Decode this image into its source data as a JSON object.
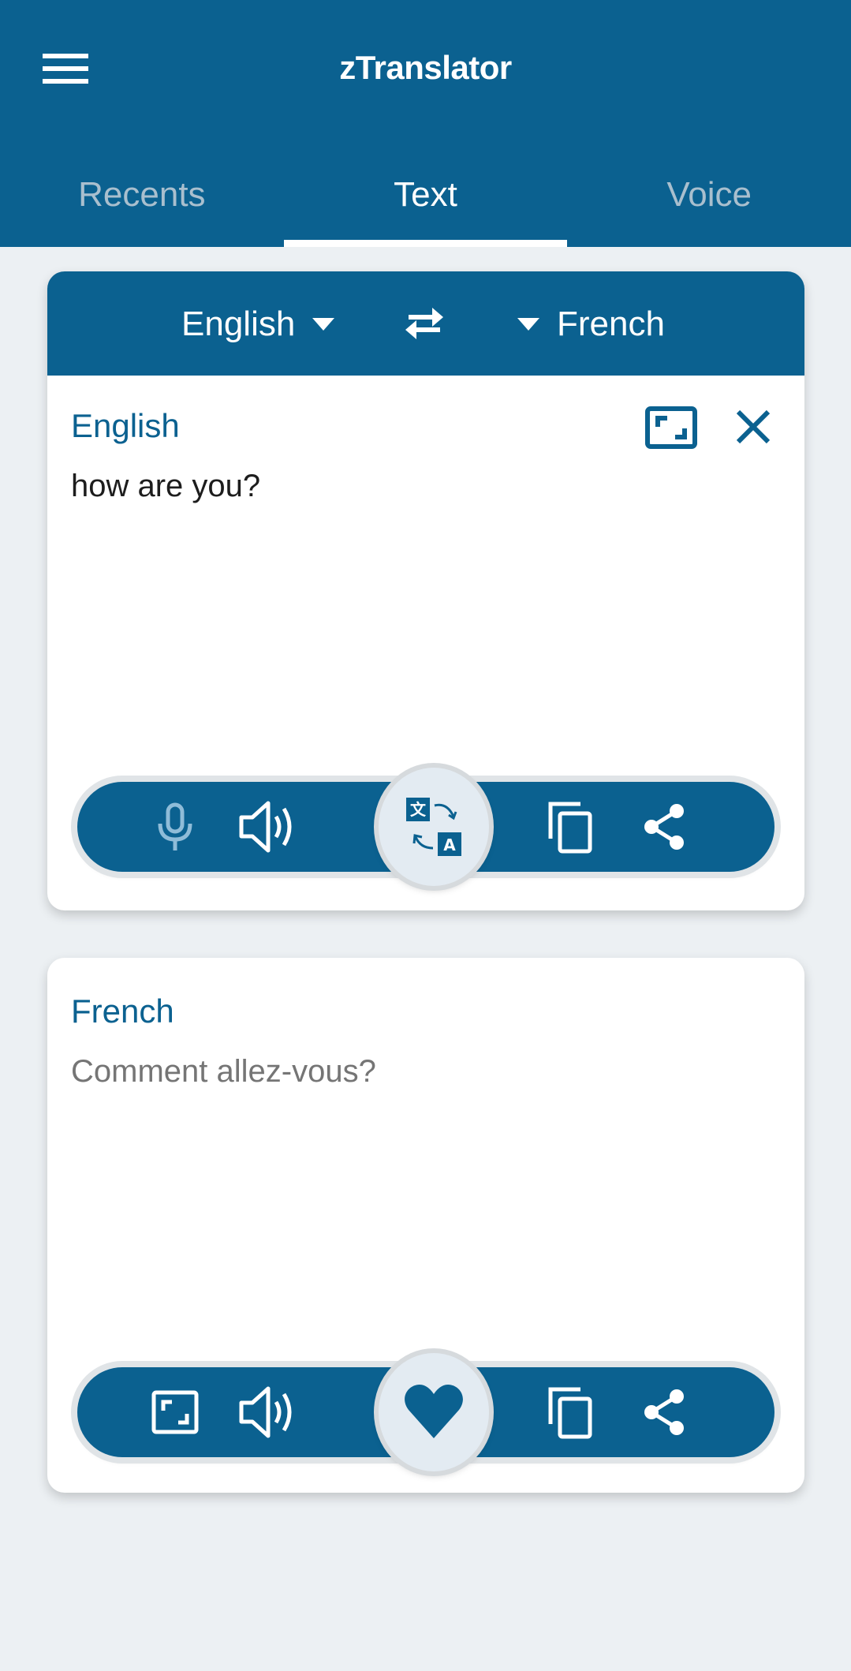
{
  "app": {
    "title": "zTranslator"
  },
  "tabs": [
    {
      "label": "Recents",
      "active": false
    },
    {
      "label": "Text",
      "active": true
    },
    {
      "label": "Voice",
      "active": false
    }
  ],
  "language_bar": {
    "source_language": "English",
    "target_language": "French"
  },
  "source_panel": {
    "label": "English",
    "text": "how are you?",
    "toolbar": [
      "mic-icon",
      "speaker-icon",
      "translate-icon",
      "copy-icon",
      "share-icon"
    ]
  },
  "target_panel": {
    "label": "French",
    "text": "Comment allez-vous?",
    "toolbar": [
      "expand-icon",
      "speaker-icon",
      "heart-icon",
      "copy-icon",
      "share-icon"
    ]
  },
  "colors": {
    "brand": "#0b6190",
    "background": "#ecf0f3",
    "center_button": "#e3ebf2",
    "inactive_tab": "#a9bfce",
    "translation_text": "#757575"
  }
}
